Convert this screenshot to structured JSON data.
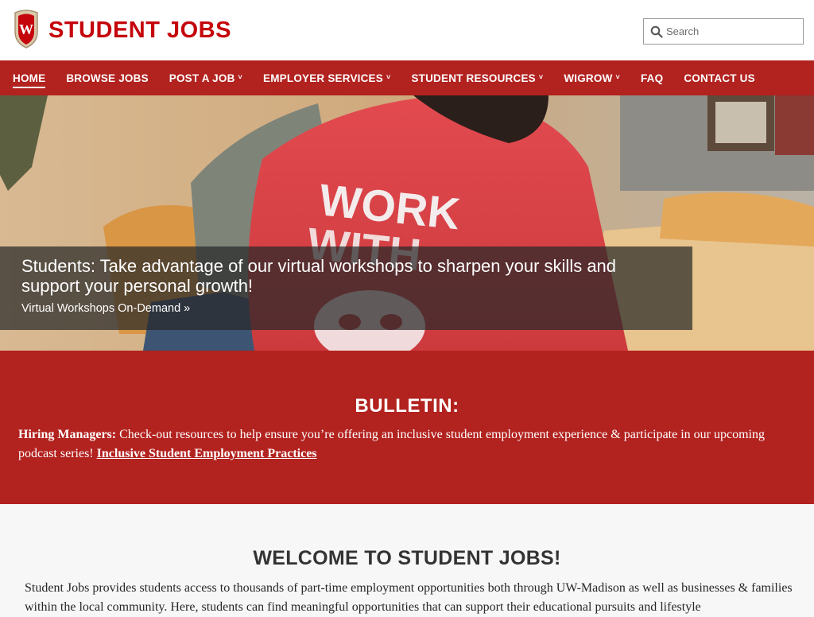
{
  "header": {
    "site_title": "STUDENT JOBS",
    "crest_letter": "W",
    "search": {
      "placeholder": "Search",
      "value": ""
    }
  },
  "nav": {
    "items": [
      {
        "label": "HOME",
        "active": true,
        "has_dropdown": false
      },
      {
        "label": "BROWSE JOBS",
        "active": false,
        "has_dropdown": false
      },
      {
        "label": "POST A JOB",
        "active": false,
        "has_dropdown": true
      },
      {
        "label": "EMPLOYER SERVICES",
        "active": false,
        "has_dropdown": true
      },
      {
        "label": "STUDENT RESOURCES",
        "active": false,
        "has_dropdown": true
      },
      {
        "label": "WIGROW",
        "active": false,
        "has_dropdown": true
      },
      {
        "label": "FAQ",
        "active": false,
        "has_dropdown": false
      },
      {
        "label": "CONTACT US",
        "active": false,
        "has_dropdown": false
      }
    ],
    "chevron_glyph": "˅"
  },
  "hero": {
    "shirt_text_line1": "WORK",
    "shirt_text_line2": "WITH",
    "headline": "Students: Take advantage of our virtual workshops to sharpen your skills and support your personal growth!",
    "link_label": "Virtual Workshops On-Demand »"
  },
  "bulletin": {
    "title": "BULLETIN:",
    "lead": "Hiring Managers:",
    "text": " Check-out resources to help ensure you’re offering an inclusive student employment experience & participate in our upcoming podcast series! ",
    "link_label": "Inclusive Student Employment Practices"
  },
  "welcome": {
    "title": "WELCOME TO STUDENT JOBS!",
    "text": "Student Jobs provides students access to thousands of part-time employment opportunities both through UW-Madison as well as businesses & families within the local community. Here, students can find meaningful opportunities that can support their educational pursuits and lifestyle"
  },
  "colors": {
    "brand_red": "#c5050c",
    "nav_red": "#b2221f",
    "caption_overlay": "#282828",
    "welcome_bg": "#f7f7f7"
  },
  "icons": [
    "uw-crest-logo",
    "search-icon",
    "chevron-down-icon"
  ]
}
